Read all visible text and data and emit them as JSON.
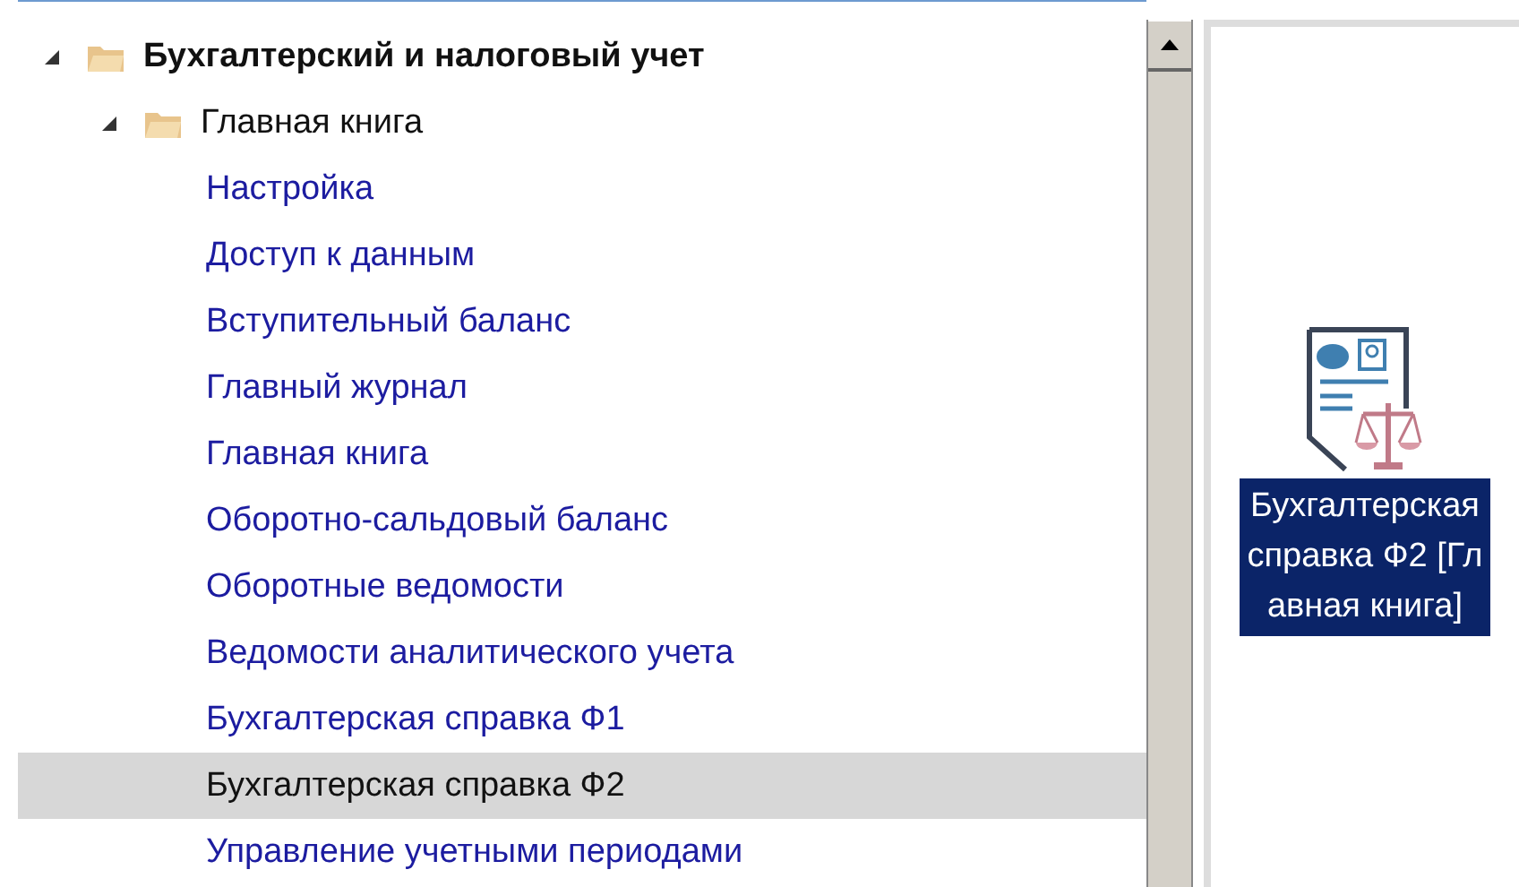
{
  "tree": [
    {
      "label": "Бухгалтерский и налоговый учет",
      "expanded": true,
      "children": [
        {
          "label": "Главная книга",
          "expanded": true,
          "children": [
            {
              "label": "Настройка",
              "selected": false
            },
            {
              "label": "Доступ к данным",
              "selected": false
            },
            {
              "label": "Вступительный баланс",
              "selected": false
            },
            {
              "label": "Главный журнал",
              "selected": false
            },
            {
              "label": "Главная книга",
              "selected": false
            },
            {
              "label": "Оборотно-сальдовый баланс",
              "selected": false
            },
            {
              "label": "Оборотные ведомости",
              "selected": false
            },
            {
              "label": "Ведомости аналитического учета",
              "selected": false
            },
            {
              "label": "Бухгалтерская справка Ф1",
              "selected": false
            },
            {
              "label": "Бухгалтерская справка Ф2",
              "selected": true
            },
            {
              "label": "Управление учетными периодами",
              "selected": false
            }
          ]
        }
      ]
    }
  ],
  "shortcut": {
    "label": "Бухгалтерская справка Ф2 [Главная книга]",
    "selected": true
  }
}
